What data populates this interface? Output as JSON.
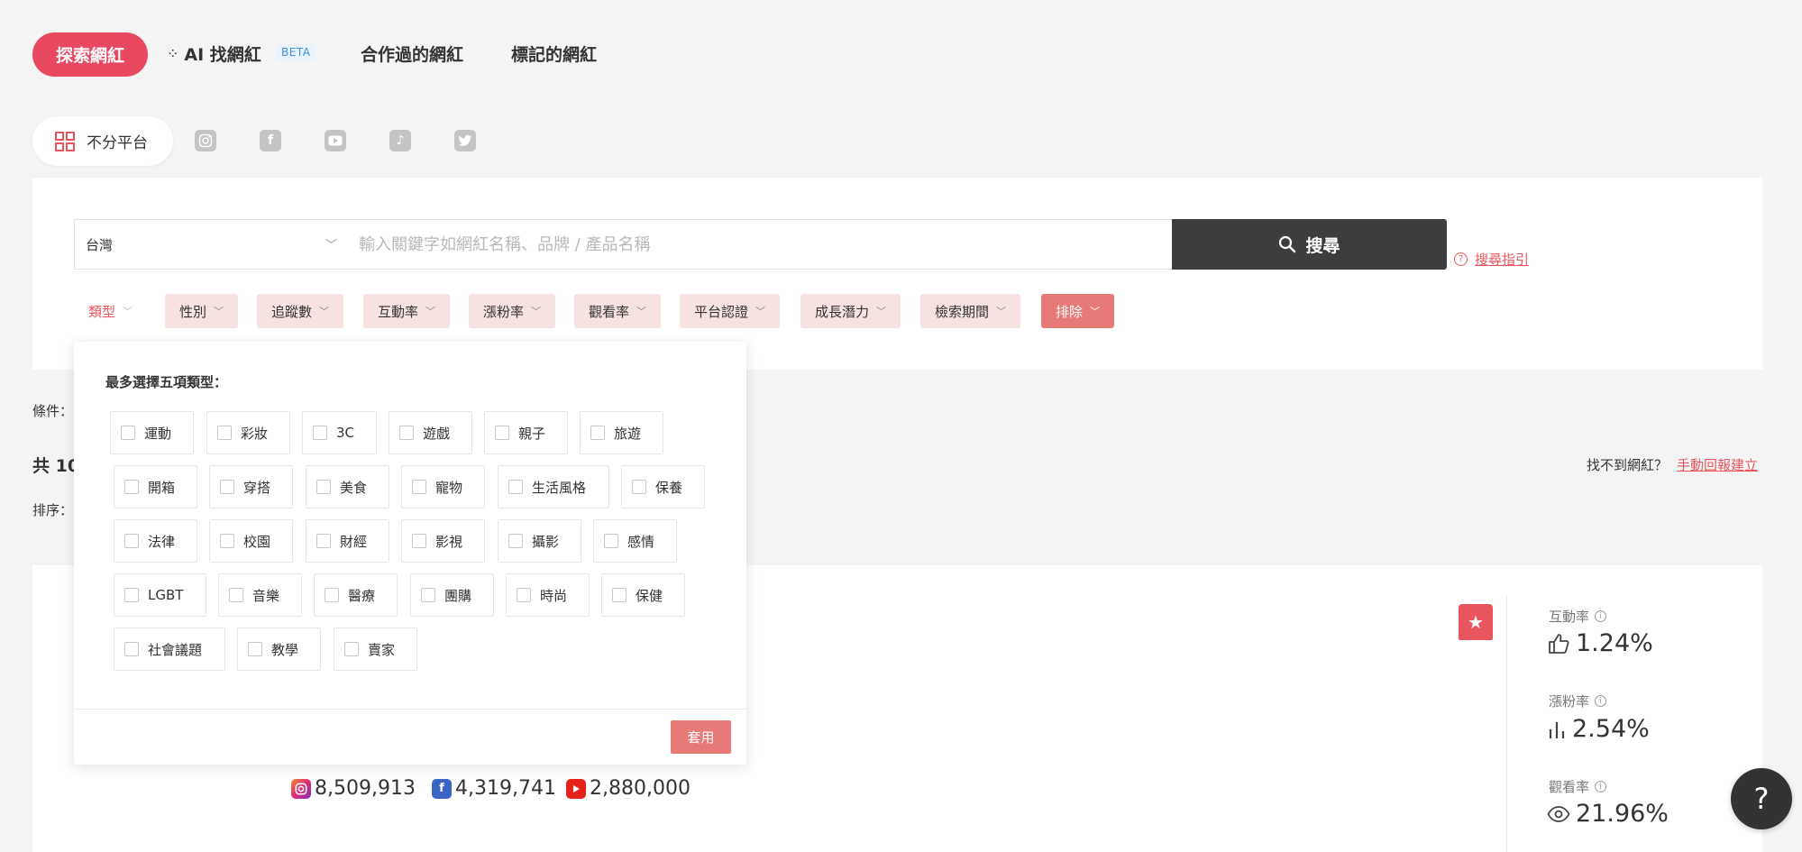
{
  "nav": {
    "explore": "探索網紅",
    "ai_find": "AI 找網紅",
    "beta": "BETA",
    "collaborated": "合作過的網紅",
    "marked": "標記的網紅"
  },
  "platforms": {
    "all_label": "不分平台",
    "icons": [
      "instagram-icon",
      "facebook-icon",
      "youtube-icon",
      "tiktok-icon",
      "twitter-icon"
    ]
  },
  "search": {
    "region": "台灣",
    "placeholder": "輸入關鍵字如網紅名稱、品牌 / 產品名稱",
    "button": "搜尋",
    "guide": "搜尋指引"
  },
  "filters": [
    "類型",
    "性別",
    "追蹤數",
    "互動率",
    "漲粉率",
    "觀看率",
    "平台認證",
    "成長潛力",
    "檢索期間",
    "排除"
  ],
  "page": {
    "conditions_label": "條件：",
    "result_prefix": "共 10",
    "sort_label": "排序：",
    "cant_find": "找不到網紅？",
    "manual_report": "手動回報建立"
  },
  "category_panel": {
    "title": "最多選擇五項類型：",
    "rows": [
      [
        "運動",
        "彩妝",
        "3C",
        "遊戲",
        "親子",
        "旅遊"
      ],
      [
        "開箱",
        "穿搭",
        "美食",
        "寵物",
        "生活風格",
        "保養"
      ],
      [
        "法律",
        "校園",
        "財經",
        "影視",
        "攝影",
        "感情"
      ],
      [
        "LGBT",
        "音樂",
        "醫療",
        "團購",
        "時尚",
        "保健"
      ],
      [
        "社會議題",
        "教學",
        "賣家"
      ]
    ],
    "apply": "套用"
  },
  "result_card": {
    "followers": {
      "instagram": "8,509,913",
      "facebook": "4,319,741",
      "youtube": "2,880,000"
    },
    "stats": [
      {
        "label": "互動率",
        "value": "1.24%",
        "icon": "thumbs-up-icon"
      },
      {
        "label": "漲粉率",
        "value": "2.54%",
        "icon": "bar-chart-icon"
      },
      {
        "label": "觀看率",
        "value": "21.96%",
        "icon": "eye-icon"
      }
    ]
  },
  "help": "?",
  "colors": {
    "accent": "#e84860",
    "chip_bg": "#f6e3e1",
    "exclude_bg": "#e77a76",
    "search_btn": "#3d3d3d"
  }
}
